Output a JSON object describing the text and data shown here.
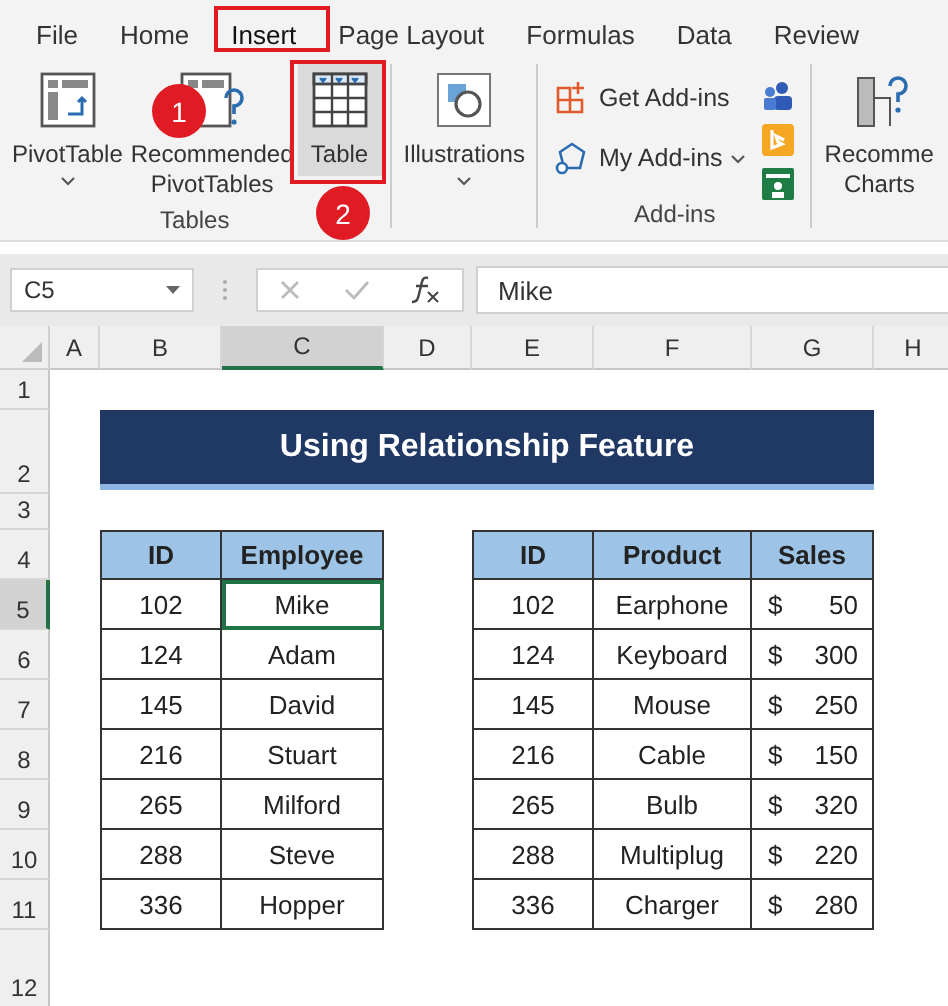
{
  "ribbon_tabs": [
    {
      "label": "File",
      "selected": false
    },
    {
      "label": "Home",
      "selected": false
    },
    {
      "label": "Insert",
      "selected": true
    },
    {
      "label": "Page Layout",
      "selected": false
    },
    {
      "label": "Formulas",
      "selected": false
    },
    {
      "label": "Data",
      "selected": false
    },
    {
      "label": "Review",
      "selected": false
    }
  ],
  "ribbon_groups": [
    {
      "kind": "buttons",
      "label": "Tables",
      "buttons": [
        {
          "kind": "pivot",
          "lines": [
            "PivotTable"
          ],
          "dropdown": true,
          "highlighted": false
        },
        {
          "kind": "recpivot",
          "lines": [
            "Recommended",
            "PivotTables"
          ],
          "dropdown": false,
          "highlighted": false
        },
        {
          "kind": "table",
          "lines": [
            "Table"
          ],
          "dropdown": false,
          "highlighted": true
        }
      ]
    },
    {
      "kind": "buttons",
      "buttons": [
        {
          "kind": "illustrations",
          "lines": [
            "Illustrations"
          ],
          "dropdown": true,
          "highlighted": false
        }
      ]
    },
    {
      "kind": "addins",
      "label": "Add-ins",
      "addins": [
        {
          "kind": "get",
          "label": "Get Add-ins",
          "dropdown": false
        },
        {
          "kind": "my",
          "label": "My Add-ins",
          "dropdown": true
        }
      ]
    },
    {
      "kind": "buttons",
      "buttons": [
        {
          "kind": "recchart",
          "lines": [
            "Recomme",
            "Charts"
          ],
          "dropdown": false,
          "highlighted": false
        }
      ]
    }
  ],
  "callouts": [
    {
      "number": "1"
    },
    {
      "number": "2"
    }
  ],
  "name_box": "C5",
  "formula": "Mike",
  "columns": [
    {
      "label": "A",
      "selected": false
    },
    {
      "label": "B",
      "selected": false
    },
    {
      "label": "C",
      "selected": true
    },
    {
      "label": "D",
      "selected": false
    },
    {
      "label": "E",
      "selected": false
    },
    {
      "label": "F",
      "selected": false
    },
    {
      "label": "G",
      "selected": false
    },
    {
      "label": "H",
      "selected": false
    }
  ],
  "rows": [
    {
      "label": "1",
      "selected": false
    },
    {
      "label": "2",
      "selected": false
    },
    {
      "label": "3",
      "selected": false
    },
    {
      "label": "4",
      "selected": false
    },
    {
      "label": "5",
      "selected": true
    },
    {
      "label": "6",
      "selected": false
    },
    {
      "label": "7",
      "selected": false
    },
    {
      "label": "8",
      "selected": false
    },
    {
      "label": "9",
      "selected": false
    },
    {
      "label": "10",
      "selected": false
    },
    {
      "label": "11",
      "selected": false
    },
    {
      "label": "12",
      "selected": false
    }
  ],
  "title": "Using Relationship Feature",
  "employee_table": {
    "columns": [
      "ID",
      "Employee"
    ],
    "rows": [
      {
        "id": "102",
        "employee": "Mike",
        "selected": true
      },
      {
        "id": "124",
        "employee": "Adam",
        "selected": false
      },
      {
        "id": "145",
        "employee": "David",
        "selected": false
      },
      {
        "id": "216",
        "employee": "Stuart",
        "selected": false
      },
      {
        "id": "265",
        "employee": "Milford",
        "selected": false
      },
      {
        "id": "288",
        "employee": "Steve",
        "selected": false
      },
      {
        "id": "336",
        "employee": "Hopper",
        "selected": false
      }
    ]
  },
  "product_table": {
    "columns": [
      "ID",
      "Product",
      "Sales"
    ],
    "rows": [
      {
        "id": "102",
        "product": "Earphone",
        "currency": "$",
        "sales": "50"
      },
      {
        "id": "124",
        "product": "Keyboard",
        "currency": "$",
        "sales": "300"
      },
      {
        "id": "145",
        "product": "Mouse",
        "currency": "$",
        "sales": "250"
      },
      {
        "id": "216",
        "product": "Cable",
        "currency": "$",
        "sales": "150"
      },
      {
        "id": "265",
        "product": "Bulb",
        "currency": "$",
        "sales": "320"
      },
      {
        "id": "288",
        "product": "Multiplug",
        "currency": "$",
        "sales": "220"
      },
      {
        "id": "336",
        "product": "Charger",
        "currency": "$",
        "sales": "280"
      }
    ]
  }
}
